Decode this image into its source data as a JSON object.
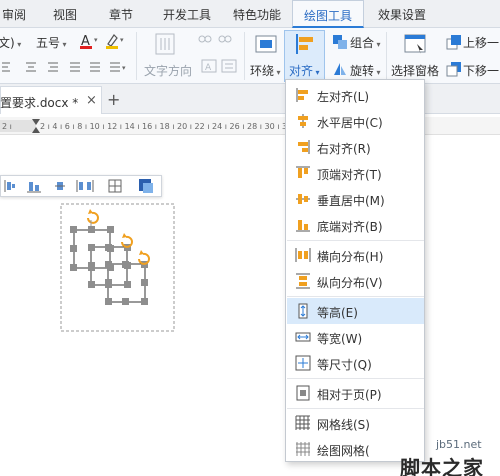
{
  "tabs": [
    {
      "label": "审阅"
    },
    {
      "label": "视图"
    },
    {
      "label": "章节"
    },
    {
      "label": "开发工具"
    },
    {
      "label": "特色功能"
    },
    {
      "label": "绘图工具"
    },
    {
      "label": "效果设置"
    }
  ],
  "ribbon": {
    "font_name": "文)",
    "font_size": "五号",
    "text_direction": "文字方向",
    "wrap": "环绕",
    "align": "对齐",
    "group": "组合",
    "rotate": "旋转",
    "selection_pane": "选择窗格",
    "move_up": "上移一",
    "move_down": "下移一"
  },
  "document_tab": {
    "name": "置要求.docx *",
    "close": "×",
    "add": "+"
  },
  "menu": {
    "items": [
      {
        "label": "左对齐(L)"
      },
      {
        "label": "水平居中(C)"
      },
      {
        "label": "右对齐(R)"
      },
      {
        "label": "顶端对齐(T)"
      },
      {
        "label": "垂直居中(M)"
      },
      {
        "label": "底端对齐(B)"
      },
      {
        "label": "横向分布(H)"
      },
      {
        "label": "纵向分布(V)"
      },
      {
        "label": "等高(E)"
      },
      {
        "label": "等宽(W)"
      },
      {
        "label": "等尺寸(Q)"
      },
      {
        "label": "相对于页(P)"
      },
      {
        "label": "网格线(S)"
      },
      {
        "label": "绘图网格("
      }
    ],
    "highlighted_item": "等高(E)"
  },
  "watermark": {
    "site": "jb51.net",
    "name": "脚本之家"
  },
  "colors": {
    "accent": "#2b7bd6",
    "highlight": "#d9eafb",
    "handle": "#8e8e8e",
    "rotate_handle": "#f0a020"
  }
}
